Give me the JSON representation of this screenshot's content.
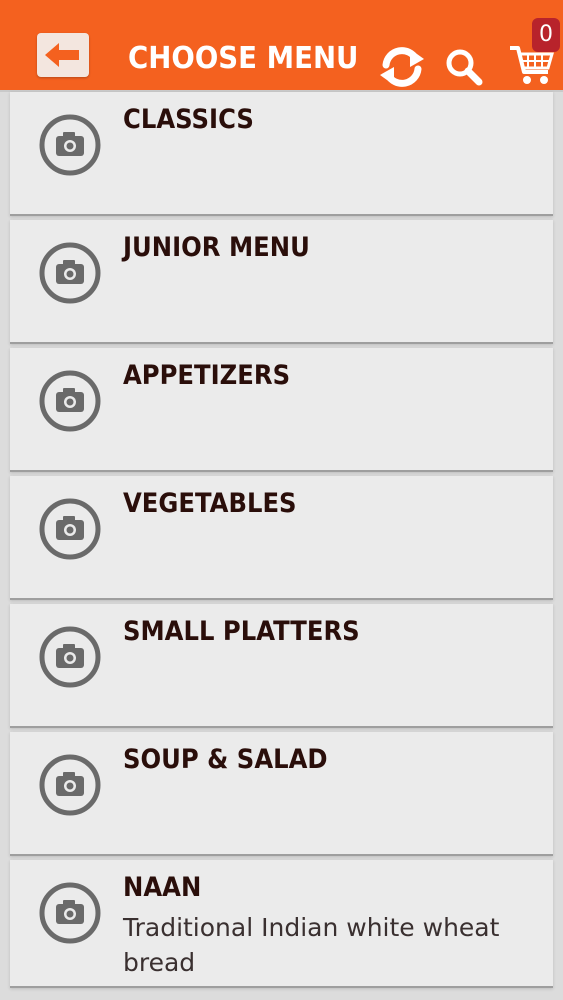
{
  "header": {
    "title": "CHOOSE MENU",
    "cart_count": "0"
  },
  "colors": {
    "header_bg": "#f4611f",
    "badge_bg": "#b8232b",
    "card_bg": "#ebebeb",
    "title_text": "#2a0e0a"
  },
  "menu": {
    "items": [
      {
        "title": "CLASSICS",
        "description": ""
      },
      {
        "title": "JUNIOR MENU",
        "description": ""
      },
      {
        "title": "APPETIZERS",
        "description": ""
      },
      {
        "title": "VEGETABLES",
        "description": ""
      },
      {
        "title": "SMALL PLATTERS",
        "description": ""
      },
      {
        "title": "SOUP & SALAD",
        "description": ""
      },
      {
        "title": "NAAN",
        "description": "Traditional Indian white wheat bread"
      }
    ]
  }
}
